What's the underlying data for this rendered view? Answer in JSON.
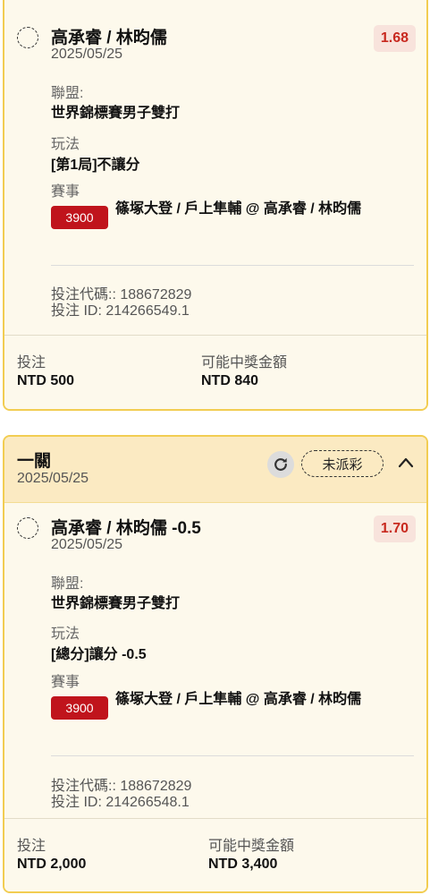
{
  "bets": [
    {
      "selection": "高承睿 / 林昀儒",
      "date": "2025/05/25",
      "odds": "1.68",
      "league_label": "聯盟:",
      "league": "世界錦標賽男子雙打",
      "play_label": "玩法",
      "play": "[第1局]不讓分",
      "event_label": "賽事",
      "event_code": "3900",
      "event": "篠塚大登 / 戶上隼輔 @ 高承睿 / 林昀儒",
      "bet_code": "投注代碼:: 188672829",
      "bet_id": "投注 ID: 214266549.1",
      "stake_label": "投注",
      "stake": "NTD 500",
      "payout_label": "可能中獎金額",
      "payout": "NTD 840"
    },
    {
      "header_title": "一關",
      "header_date": "2025/05/25",
      "status": "未派彩",
      "selection": "高承睿 / 林昀儒 -0.5",
      "date": "2025/05/25",
      "odds": "1.70",
      "league_label": "聯盟:",
      "league": "世界錦標賽男子雙打",
      "play_label": "玩法",
      "play": "[總分]讓分 -0.5",
      "event_label": "賽事",
      "event_code": "3900",
      "event": "篠塚大登 / 戶上隼輔 @ 高承睿 / 林昀儒",
      "bet_code": "投注代碼:: 188672829",
      "bet_id": "投注 ID: 214266548.1",
      "stake_label": "投注",
      "stake": "NTD 2,000",
      "payout_label": "可能中獎金額",
      "payout": "NTD 3,400"
    }
  ],
  "icons": {
    "refresh": "refresh-icon",
    "collapse": "chevron-up-icon",
    "selection_status": "pending-circle-icon"
  },
  "colors": {
    "card_border": "#f2cd52",
    "header_bg": "#fbeac2",
    "odds_text": "#c8291f",
    "badge_bg": "#c0141c"
  }
}
